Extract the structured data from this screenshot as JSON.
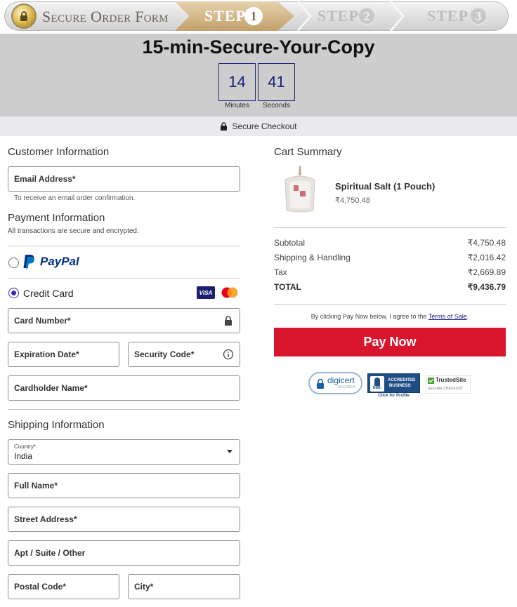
{
  "stepbar": {
    "form_label": "Secure Order Form",
    "step_label": "STEP",
    "steps": [
      "1",
      "2",
      "3"
    ]
  },
  "timer": {
    "title": "15-min-Secure-Your-Copy",
    "minutes": "14",
    "seconds": "41",
    "minutes_label": "Minutes",
    "seconds_label": "Seconds"
  },
  "secure_checkout_label": "Secure Checkout",
  "customer": {
    "heading": "Customer Information",
    "email_placeholder": "Email Address*",
    "email_helper": "To receive an email order confirmation."
  },
  "payment": {
    "heading": "Payment Information",
    "subheading": "All transactions are secure and encrypted.",
    "paypal_label": "PayPal",
    "credit_card_label": "Credit Card",
    "card_number_placeholder": "Card Number*",
    "expiration_placeholder": "Expiration Date*",
    "security_code_placeholder": "Security Code*",
    "cardholder_placeholder": "Cardholder Name*",
    "visa_label": "VISA",
    "selected_method": "credit_card"
  },
  "shipping": {
    "heading": "Shipping Information",
    "country_label": "Country*",
    "country_value": "India",
    "full_name_placeholder": "Full Name*",
    "street_placeholder": "Street Address*",
    "apt_placeholder": "Apt / Suite / Other",
    "postal_placeholder": "Postal Code*",
    "city_placeholder": "City*"
  },
  "cart": {
    "heading": "Cart Summary",
    "item_name": "Spiritual Salt (1 Pouch)",
    "item_price": "₹4,750.48",
    "subtotal_label": "Subtotal",
    "subtotal_value": "₹4,750.48",
    "shipping_label": "Shipping & Handling",
    "shipping_value": "₹2,016.42",
    "tax_label": "Tax",
    "tax_value": "₹2,669.89",
    "total_label": "TOTAL",
    "total_value": "₹9,436.79",
    "terms_prefix": "By clicking Pay Now below, I agree to the ",
    "terms_link": "Terms of Sale",
    "terms_suffix": ".",
    "pay_button": "Pay Now"
  },
  "badges": {
    "digicert": "digicert",
    "digicert_sub": "SECURED",
    "bbb_line1": "ACCREDITED",
    "bbb_line2": "BUSINESS",
    "bbb_mark": "BBB.",
    "bbb_profile": "Click for Profile",
    "trustedsite": "TrustedSite",
    "trustedsite_sub": "SECURE CHECKOUT"
  },
  "colors": {
    "pay_button": "#d9152e",
    "timer_border": "#202a7a",
    "radio_selected": "#3a2cae",
    "paypal_dark": "#003087",
    "paypal_light": "#0079c1"
  }
}
